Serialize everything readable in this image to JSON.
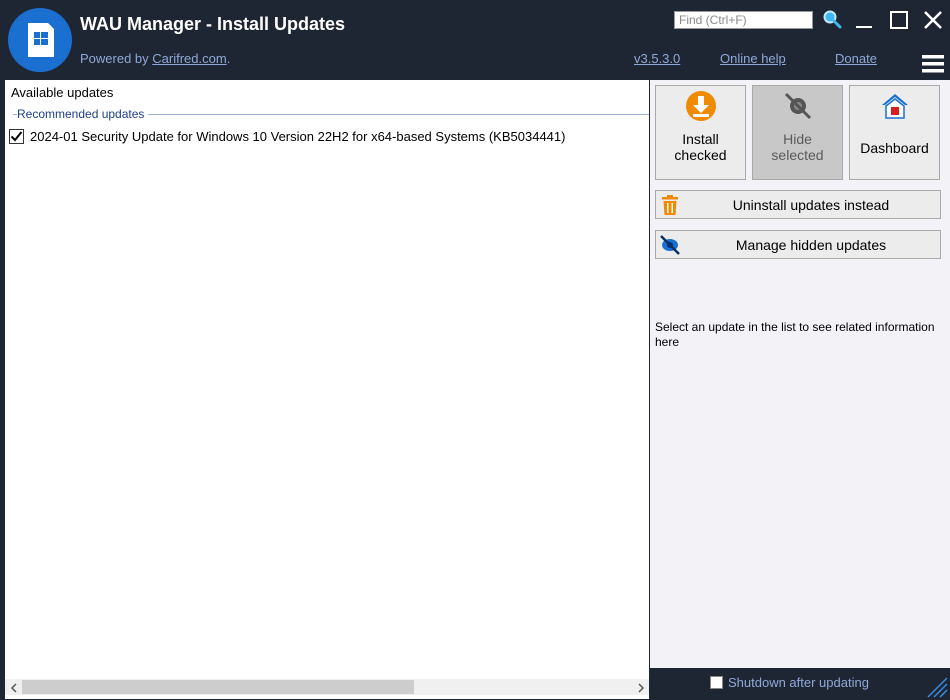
{
  "app": {
    "title": "WAU Manager - Install Updates",
    "powered_prefix": "Powered by ",
    "powered_link": "Carifred.com",
    "powered_suffix": ".",
    "version": "v3.5.3.0",
    "online_help": "Online help",
    "donate": "Donate"
  },
  "search": {
    "placeholder": "Find (Ctrl+F)"
  },
  "updates_list": {
    "title": "Available updates",
    "groups": [
      {
        "name": "Recommended updates",
        "items": [
          {
            "label": "2024-01 Security Update for Windows 10 Version 22H2 for x64-based Systems (KB5034441)",
            "checked": true
          }
        ]
      }
    ]
  },
  "actions": {
    "install_line1": "Install",
    "install_line2": "checked",
    "hide_line1": "Hide",
    "hide_line2": "selected",
    "dashboard": "Dashboard",
    "uninstall": "Uninstall updates instead",
    "manage_hidden": "Manage hidden updates"
  },
  "info": {
    "text": "Select an update in the list to see related information here"
  },
  "footer": {
    "shutdown_label": "Shutdown after updating",
    "shutdown_checked": false
  },
  "colors": {
    "titlebar_bg": "#1f2633",
    "link": "#8fa8d8",
    "accent_orange": "#f08a00",
    "accent_blue": "#1a6fd0"
  }
}
